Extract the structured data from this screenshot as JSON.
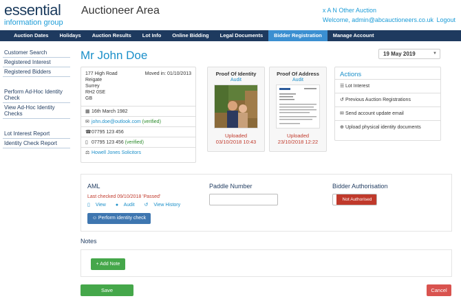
{
  "header": {
    "logo_line1": "essential",
    "logo_line2": "information group",
    "area_title": "Auctioneer Area",
    "auction_name": "x A N Other Auction",
    "welcome": "Welcome, admin@abcauctioneers.co.uk",
    "logout": "Logout"
  },
  "nav": {
    "items": [
      "Auction Dates",
      "Holidays",
      "Auction Results",
      "Lot Info",
      "Online Bidding",
      "Legal Documents",
      "Bidder Registration",
      "Manage Account"
    ],
    "active": "Bidder Registration"
  },
  "sidebar": {
    "group1": [
      "Customer Search",
      "Registered Interest",
      "Registered Bidders"
    ],
    "group2": [
      "Perform Ad-Hoc Identity Check",
      "View Ad-Hoc Identity Checks"
    ],
    "group3": [
      "Lot Interest Report",
      "Identity Check Report"
    ]
  },
  "person": {
    "name": "Mr John Doe",
    "address": [
      "177 High Road",
      "Reigate",
      "Surrey",
      "RH2 0SE",
      "GB"
    ],
    "moved_in": "Moved in: 01/10/2013",
    "dob": "16th March 1982",
    "email": "john.doe@outlook.com",
    "email_status": "(verified)",
    "phone": "07795 123 456",
    "mobile": "07795 123 456",
    "mobile_status": "(verified)",
    "solicitor": "Howell Jones Solicitors"
  },
  "date_select": {
    "value": "19 May 2019"
  },
  "proof_identity": {
    "title": "Proof Of Identity",
    "audit": "Audit",
    "status": "Uploaded",
    "timestamp": "03/10/2018 10:43"
  },
  "proof_address": {
    "title": "Proof Of Address",
    "audit": "Audit",
    "status": "Uploaded",
    "timestamp": "23/10/2018 12:22"
  },
  "actions": {
    "title": "Actions",
    "items": [
      "Lot Interest",
      "Previous Auction Registrations",
      "Send account update email",
      "Upload physical identity documents"
    ]
  },
  "aml": {
    "title": "AML",
    "last_checked": "Last checked 09/10/2018 'Passed'",
    "view": "View",
    "audit": "Audit",
    "view_history": "View History",
    "perform_button": "Perform identity check"
  },
  "paddle": {
    "title": "Paddle Number",
    "value": ""
  },
  "authorisation": {
    "title": "Bidder Authorisation",
    "state": "Not Authorised"
  },
  "notes": {
    "title": "Notes",
    "add_button": "+ Add Note"
  },
  "footer": {
    "save": "Save",
    "cancel": "Cancel"
  },
  "colors": {
    "brand_navy": "#1e3a5f",
    "accent_blue": "#1a8fc9",
    "success_green": "#45a74a",
    "danger_red": "#c0392b"
  }
}
